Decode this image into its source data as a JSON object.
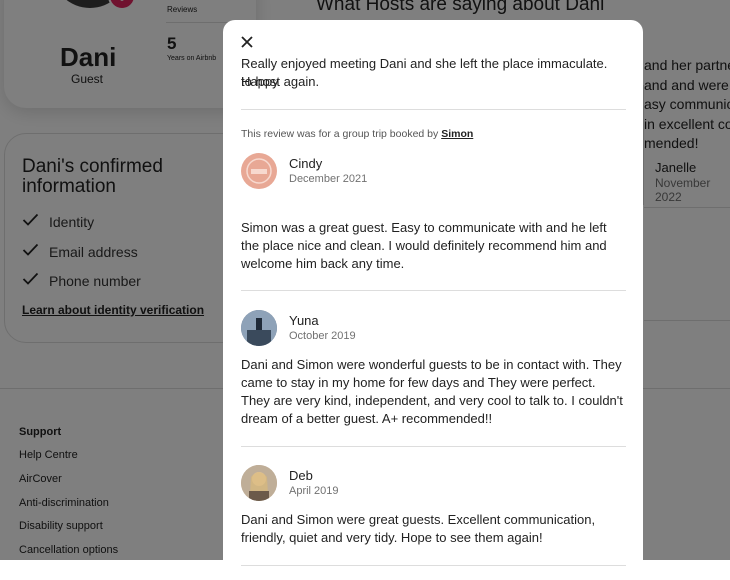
{
  "profile": {
    "name": "Dani",
    "role": "Guest",
    "stats": {
      "reviews_label": "Reviews",
      "years_value": "5",
      "years_label": "Years on Airbnb"
    }
  },
  "host_section": {
    "title": "What Hosts are saying about Dani",
    "partial_review_lines": [
      "and her partner s",
      "and and were per",
      "asy communica",
      "in excellent cond",
      "mended!"
    ],
    "partial_reviewer_name": "Janelle",
    "partial_reviewer_date": "November 2022"
  },
  "confirmed": {
    "title": "Dani's confirmed information",
    "items": [
      {
        "label": "Identity"
      },
      {
        "label": "Email address"
      },
      {
        "label": "Phone number"
      }
    ],
    "link": "Learn about identity verification"
  },
  "footer": {
    "heading": "Support",
    "links": [
      "Help Centre",
      "AirCover",
      "Anti-discrimination",
      "Disability support",
      "Cancellation options"
    ]
  },
  "modal": {
    "close_icon": "close-icon",
    "cut_text_line1": "Really enjoyed meeting Dani and she left the place immaculate. Happy",
    "cut_text_line2": "to host again.",
    "trip_note_prefix": "This review was for a group trip booked by",
    "trip_note_link": "Simon",
    "reviews": [
      {
        "name": "Cindy",
        "date": "December 2021",
        "text": "Simon was a great guest. Easy to communicate with and he left the place nice and clean. I would definitely recommend him and welcome him back any time."
      },
      {
        "name": "Yuna",
        "date": "October 2019",
        "text": "Dani and Simon were wonderful guests to be in contact with. They came to stay in my home for few days and They were perfect. They are very kind, independent, and very cool to talk to. I couldn't dream of a better guest. A+ recommended!!"
      },
      {
        "name": "Deb",
        "date": "April 2019",
        "text": "Dani and Simon were great guests. Excellent communication, friendly, quiet and very tidy. Hope to see them again!"
      }
    ]
  },
  "colors": {
    "badge": "#e0245e",
    "overlay": "rgba(0,0,0,0.5)",
    "divider": "#dddddd",
    "muted": "#717171"
  }
}
